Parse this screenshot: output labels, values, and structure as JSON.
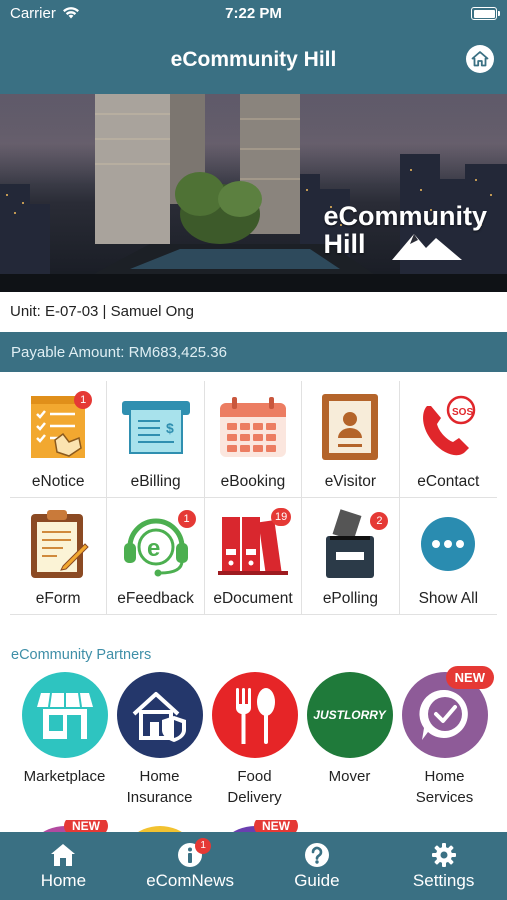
{
  "status_bar": {
    "carrier": "Carrier",
    "time": "7:22 PM"
  },
  "header": {
    "title": "eCommunity Hill"
  },
  "banner": {
    "logo_line1": "eCommunity",
    "logo_line2": "Hill"
  },
  "unit_info": "Unit: E-07-03 | Samuel Ong",
  "payable": "Payable Amount: RM683,425.36",
  "modules": [
    {
      "label": "eNotice",
      "icon": "notice-icon",
      "badge": "1"
    },
    {
      "label": "eBilling",
      "icon": "billing-icon",
      "badge": ""
    },
    {
      "label": "eBooking",
      "icon": "calendar-icon",
      "badge": ""
    },
    {
      "label": "eVisitor",
      "icon": "visitor-icon",
      "badge": ""
    },
    {
      "label": "eContact",
      "icon": "sos-phone-icon",
      "badge": ""
    },
    {
      "label": "eForm",
      "icon": "clipboard-icon",
      "badge": ""
    },
    {
      "label": "eFeedback",
      "icon": "headset-icon",
      "badge": "1"
    },
    {
      "label": "eDocument",
      "icon": "binders-icon",
      "badge": "19"
    },
    {
      "label": "ePolling",
      "icon": "ballot-box-icon",
      "badge": "2"
    },
    {
      "label": "Show All",
      "icon": "more-icon",
      "badge": ""
    }
  ],
  "partners_title": "eCommunity Partners",
  "partners": [
    {
      "label_line1": "Marketplace",
      "label_line2": "",
      "icon": "storefront-icon",
      "color": "#2ec4c0",
      "new": ""
    },
    {
      "label_line1": "Home",
      "label_line2": "Insurance",
      "icon": "house-shield-icon",
      "color": "#24376b",
      "new": ""
    },
    {
      "label_line1": "Food",
      "label_line2": "Delivery",
      "icon": "fork-spoon-icon",
      "color": "#e62527",
      "new": ""
    },
    {
      "label_line1": "Mover",
      "label_line2": "",
      "icon": "justlorry-logo",
      "logo_text": "JUSTLORRY",
      "color": "#1f7a3a",
      "new": ""
    },
    {
      "label_line1": "Home",
      "label_line2": "Services",
      "icon": "check-bubble-icon",
      "color": "#8e5b98",
      "new": "NEW"
    }
  ],
  "peek_new": "NEW",
  "tabs": [
    {
      "label": "Home",
      "icon": "home-icon",
      "badge": ""
    },
    {
      "label": "eComNews",
      "icon": "info-icon",
      "badge": "1"
    },
    {
      "label": "Guide",
      "icon": "help-icon",
      "badge": ""
    },
    {
      "label": "Settings",
      "icon": "gear-icon",
      "badge": ""
    }
  ],
  "colors": {
    "primary": "#3a7083",
    "badge": "#e53935",
    "partner_title": "#3f8fa8"
  }
}
